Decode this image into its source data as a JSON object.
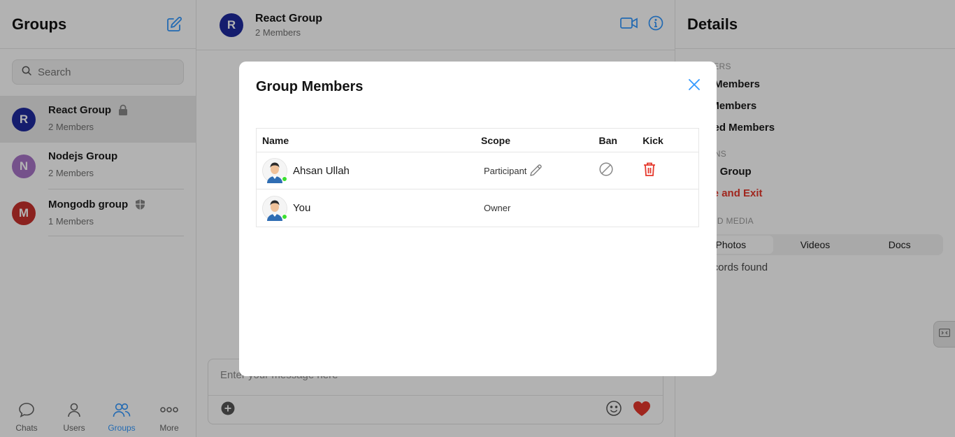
{
  "sidebar": {
    "title": "Groups",
    "search_placeholder": "Search",
    "groups": [
      {
        "initial": "R",
        "name": "React Group",
        "members": "2 Members",
        "color": "#1f2a9e",
        "badge": "lock-icon"
      },
      {
        "initial": "N",
        "name": "Nodejs Group",
        "members": "2 Members",
        "color": "#a875c8",
        "badge": ""
      },
      {
        "initial": "M",
        "name": "Mongodb group",
        "members": "1 Members",
        "color": "#c8322d",
        "badge": "shield-icon"
      }
    ],
    "nav": [
      {
        "label": "Chats",
        "icon": "chat-bubble-icon"
      },
      {
        "label": "Users",
        "icon": "user-icon"
      },
      {
        "label": "Groups",
        "icon": "groups-icon"
      },
      {
        "label": "More",
        "icon": "more-dots-icon"
      }
    ]
  },
  "chat": {
    "initial": "R",
    "name": "React Group",
    "members": "2 Members",
    "composer_placeholder": "Enter your message here"
  },
  "details": {
    "title": "Details",
    "sections": [
      {
        "title": "Members",
        "items": [
          "View Members",
          "Add Members",
          "Banned Members"
        ]
      },
      {
        "title": "Options",
        "items": [
          "Leave Group",
          "Delete and Exit"
        ]
      },
      {
        "title": "Shared Media",
        "items": []
      }
    ],
    "media_tabs": [
      "Photos",
      "Videos",
      "Docs"
    ],
    "no_records": "No records found"
  },
  "modal": {
    "title": "Group Members",
    "columns": {
      "name": "Name",
      "scope": "Scope",
      "ban": "Ban",
      "kick": "Kick"
    },
    "members": [
      {
        "name": "Ahsan Ullah",
        "scope": "Participant"
      },
      {
        "name": "You",
        "scope": "Owner"
      }
    ]
  },
  "colors": {
    "accent": "#3399ff",
    "danger": "#e5372b",
    "online": "#3bdf2f"
  }
}
